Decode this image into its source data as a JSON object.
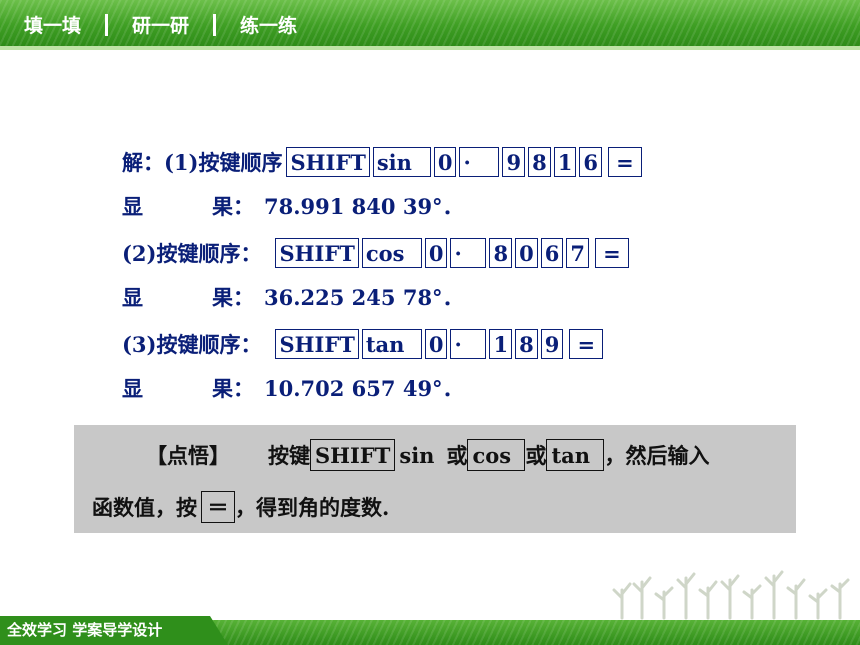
{
  "nav": {
    "tabs": [
      "填一填",
      "研一研",
      "练一练"
    ]
  },
  "solution": {
    "line1": {
      "prefix": "解：",
      "text": "(1)按键顺序",
      "keys": [
        "SHIFT",
        "sin",
        "0",
        "·",
        "9",
        "8",
        "1",
        "6",
        "="
      ]
    },
    "line2": {
      "label": "显",
      "label2": "果：",
      "value": "78.991 840 39°．"
    },
    "line3": {
      "text": "(2)按键顺序：",
      "keys": [
        "SHIFT",
        "cos",
        "0",
        "·",
        "8",
        "0",
        "6",
        "7",
        "="
      ]
    },
    "line4": {
      "label": "显",
      "label2": "果：",
      "value": "36.225 245 78°．"
    },
    "line5": {
      "text": "(3)按键顺序：",
      "keys": [
        "SHIFT",
        "tan",
        "0",
        "·",
        "1",
        "8",
        "9",
        "="
      ]
    },
    "line6": {
      "label": "显",
      "label2": "果：",
      "value": "10.702 657 49°．"
    }
  },
  "note": {
    "title": "【点悟】",
    "t1": "按键",
    "k_shift": "SHIFT",
    "t_sin": "sin",
    "t_or1": "或",
    "k_cos": "cos",
    "t_or2": "或",
    "k_tan": "tan",
    "t2": "，然后输入",
    "t3": "函数值，按",
    "k_eq": "＝",
    "t4": "，得到角的度数."
  },
  "footer": {
    "text": "全效学习  学案导学设计"
  },
  "colors": {
    "green_dark": "#2e8c18",
    "green_light": "#6cc04a",
    "text_blue": "#0a1f78",
    "note_bg": "#c8c8c8"
  }
}
